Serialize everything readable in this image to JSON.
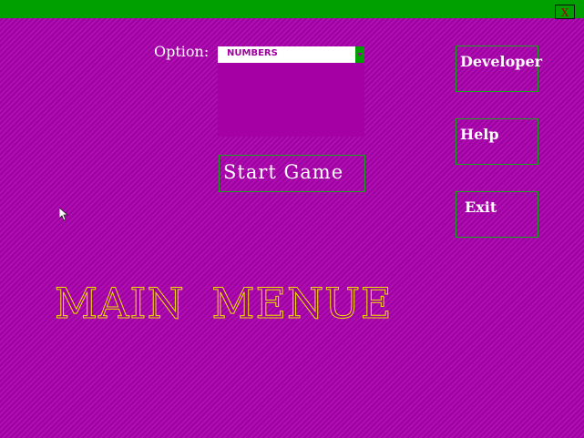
{
  "window": {
    "close_label": "X"
  },
  "option": {
    "label": "Option:",
    "selected": "NUMBERS"
  },
  "buttons": {
    "start": "Start Game",
    "developer": "Developer",
    "help": "Help",
    "exit": "Exit"
  },
  "title": "MAIN MENUE",
  "colors": {
    "background": "#a000a0",
    "titlebar": "#00a000",
    "title_outline": "#f0e000",
    "button_border": "#20a020"
  },
  "icons": {
    "cursor": "mouse-pointer-icon",
    "dropdown": "dropdown-arrow-icon"
  }
}
